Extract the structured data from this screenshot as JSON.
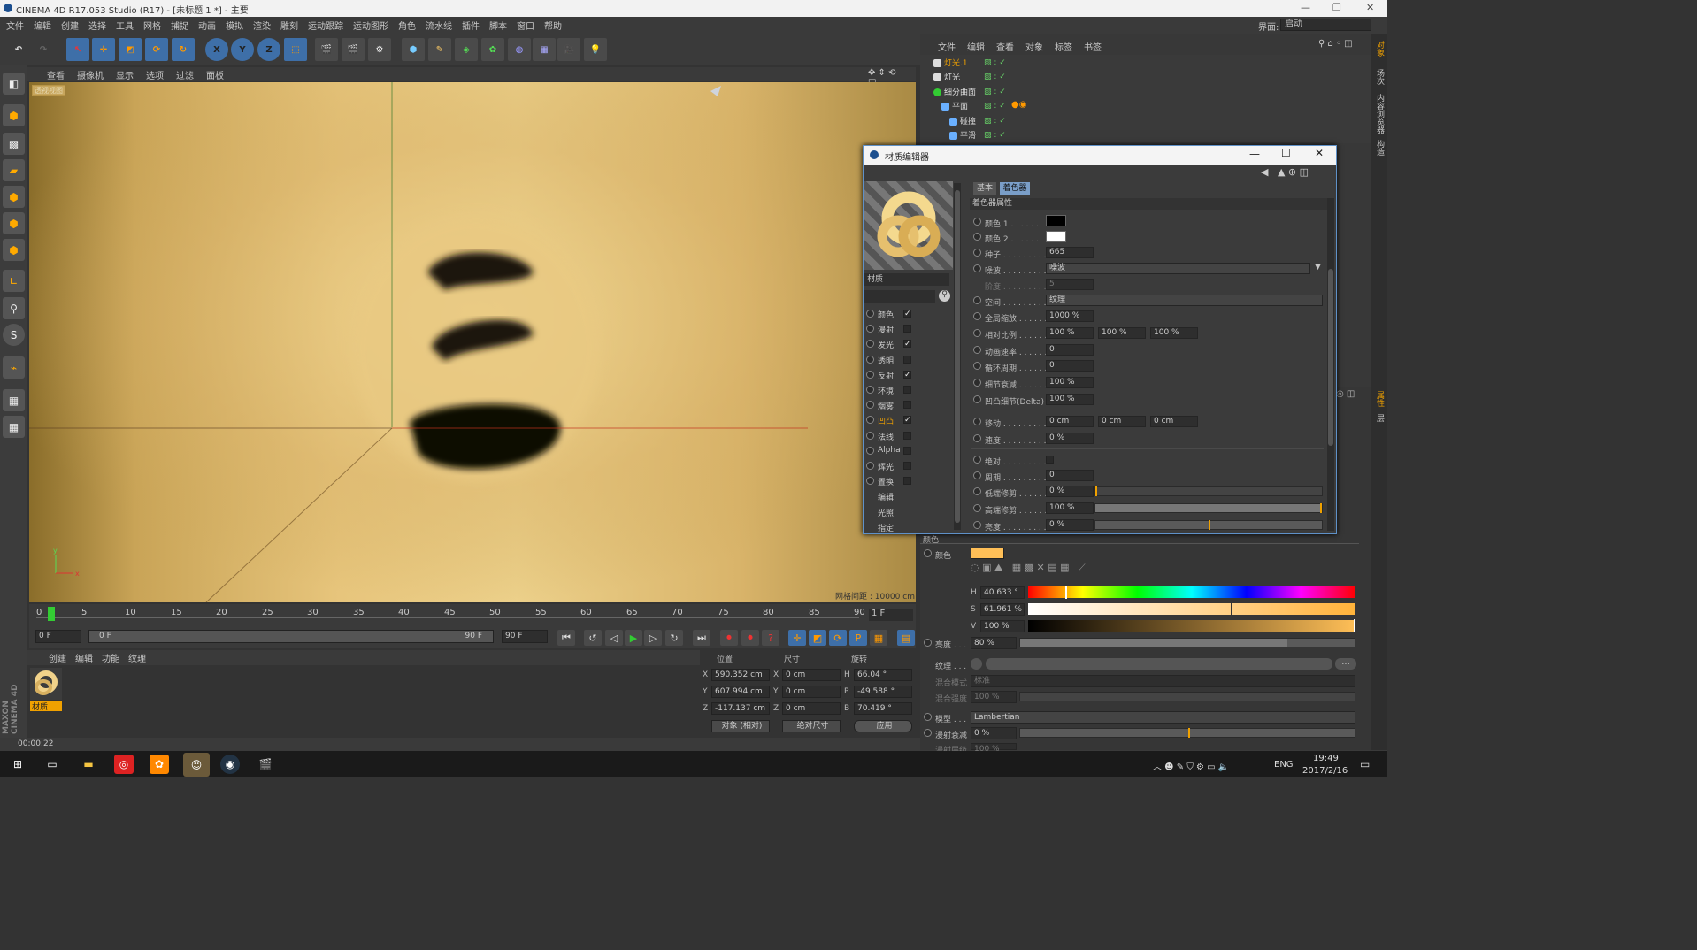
{
  "titlebar": {
    "title": "CINEMA 4D R17.053 Studio (R17) - [未标题 1 *] - 主要"
  },
  "menubar": {
    "items": [
      "文件",
      "编辑",
      "创建",
      "选择",
      "工具",
      "网格",
      "捕捉",
      "动画",
      "模拟",
      "渲染",
      "雕刻",
      "运动跟踪",
      "运动图形",
      "角色",
      "流水线",
      "插件",
      "脚本",
      "窗口",
      "帮助"
    ],
    "layout_label": "界面:",
    "layout_value": "启动"
  },
  "toolbar": {
    "axis_x": "X",
    "axis_y": "Y",
    "axis_z": "Z"
  },
  "viewport": {
    "menu": [
      "查看",
      "摄像机",
      "显示",
      "选项",
      "过滤",
      "面板"
    ],
    "badge": "透视视图",
    "grid_label": "网格间距 : 10000 cm"
  },
  "timeline": {
    "ticks": [
      "0",
      "5",
      "10",
      "15",
      "20",
      "25",
      "30",
      "35",
      "40",
      "45",
      "50",
      "55",
      "60",
      "65",
      "70",
      "75",
      "80",
      "85",
      "90"
    ],
    "frame_end": "1 F"
  },
  "playbar": {
    "start": "0 F",
    "range_start": "0 F",
    "range_end": "90 F",
    "end": "90 F"
  },
  "material_manager": {
    "menu": [
      "创建",
      "编辑",
      "功能",
      "纹理"
    ],
    "material_name": "材质"
  },
  "coordinates": {
    "headers": [
      "位置",
      "尺寸",
      "旋转"
    ],
    "rows": [
      {
        "axis": "X",
        "pos": "590.352 cm",
        "size_axis": "X",
        "size": "0 cm",
        "rot_axis": "H",
        "rot": "66.04 °"
      },
      {
        "axis": "Y",
        "pos": "607.994 cm",
        "size_axis": "Y",
        "size": "0 cm",
        "rot_axis": "P",
        "rot": "-49.588 °"
      },
      {
        "axis": "Z",
        "pos": "-117.137 cm",
        "size_axis": "Z",
        "size": "0 cm",
        "rot_axis": "B",
        "rot": "70.419 °"
      }
    ],
    "mode": "对象 (相对)",
    "size_mode": "绝对尺寸",
    "apply": "应用"
  },
  "status": {
    "time": "00:00:22"
  },
  "object_manager": {
    "menu": [
      "文件",
      "编辑",
      "查看",
      "对象",
      "标签",
      "书签"
    ],
    "objects": [
      "灯光.1",
      "灯光",
      "细分曲面",
      "平面",
      "碰撞",
      "平滑"
    ]
  },
  "right_tabs": [
    "对象",
    "场次",
    "内容浏览器",
    "构造",
    "属性",
    "层"
  ],
  "dialog": {
    "title": "材质编辑器",
    "tabs": [
      "基本",
      "着色器"
    ],
    "section": "着色器属性",
    "preview_label": "材质",
    "channels": [
      {
        "name": "颜色",
        "checked": "✓"
      },
      {
        "name": "漫射",
        "checked": ""
      },
      {
        "name": "发光",
        "checked": "✓"
      },
      {
        "name": "透明",
        "checked": ""
      },
      {
        "name": "反射",
        "checked": "✓"
      },
      {
        "name": "环境",
        "checked": ""
      },
      {
        "name": "烟雾",
        "checked": ""
      },
      {
        "name": "凹凸",
        "checked": "✓"
      },
      {
        "name": "法线",
        "checked": ""
      },
      {
        "name": "Alpha",
        "checked": ""
      },
      {
        "name": "辉光",
        "checked": ""
      },
      {
        "name": "置换",
        "checked": ""
      },
      {
        "name": "编辑",
        "checked": ""
      },
      {
        "name": "光照",
        "checked": ""
      },
      {
        "name": "指定",
        "checked": ""
      }
    ],
    "props": {
      "color1": "颜色 1 . . . . . .",
      "color2": "颜色 2 . . . . . .",
      "seed": "种子 . . . . . . . . .",
      "seed_val": "665",
      "noise": "噪波 . . . . . . . . .",
      "noise_val": "噪波",
      "octaves": "阶度 . . . . . . . . .",
      "octaves_val": "5",
      "space": "空间 . . . . . . . . .",
      "space_val": "纹理",
      "gscale": "全局缩放 . . . . . .",
      "gscale_val": "1000 %",
      "rscale": "相对比例 . . . . . .",
      "rscale_vals": [
        "100 %",
        "100 %",
        "100 %"
      ],
      "anim": "动画速率 . . . . . .",
      "anim_val": "0",
      "loop": "循环周期 . . . . . .",
      "loop_val": "0",
      "detail": "细节衰减 . . . . . .",
      "detail_val": "100 %",
      "delta": "凹凸细节(Delta)",
      "delta_val": "100 %",
      "move": "移动 . . . . . . . . .",
      "move_vals": [
        "0 cm",
        "0 cm",
        "0 cm"
      ],
      "speed": "速度 . . . . . . . . .",
      "speed_val": "0 %",
      "abs": "绝对 . . . . . . . . .",
      "period": "周期 . . . . . . . . .",
      "period_val": "0",
      "low": "低端修剪 . . . . . .",
      "low_val": "0 %",
      "high": "高端修剪 . . . . . .",
      "high_val": "100 %",
      "bright": "亮度 . . . . . . . . .",
      "bright_val": "0 %"
    }
  },
  "attributes": {
    "section": "颜色",
    "color_label": "颜色",
    "color_hex": "#ffbf57",
    "h_label": "H",
    "h": "40.633 °",
    "s_label": "S",
    "s": "61.961 %",
    "v_label": "V",
    "v": "100 %",
    "brightness_label": "亮度 . . .",
    "brightness": "80 %",
    "texture_label": "纹理 . . .",
    "mix_mode_label": "混合模式",
    "mix_mode": "标准",
    "mix_strength_label": "混合强度",
    "mix_strength": "100 %",
    "model_label": "模型 . . .",
    "model": "Lambertian",
    "diffuse_label": "漫射衰减",
    "diffuse": "0 %",
    "diffuse2_label": "漫射层级",
    "diffuse2": "100 %",
    "h_fraction": 0.113,
    "s_fraction": 0.62,
    "v_fraction": 1.0,
    "brightness_fraction": 0.8,
    "diffuse_fraction": 0.5
  },
  "taskbar": {
    "lang": "ENG",
    "time": "19:49",
    "date": "2017/2/16"
  }
}
